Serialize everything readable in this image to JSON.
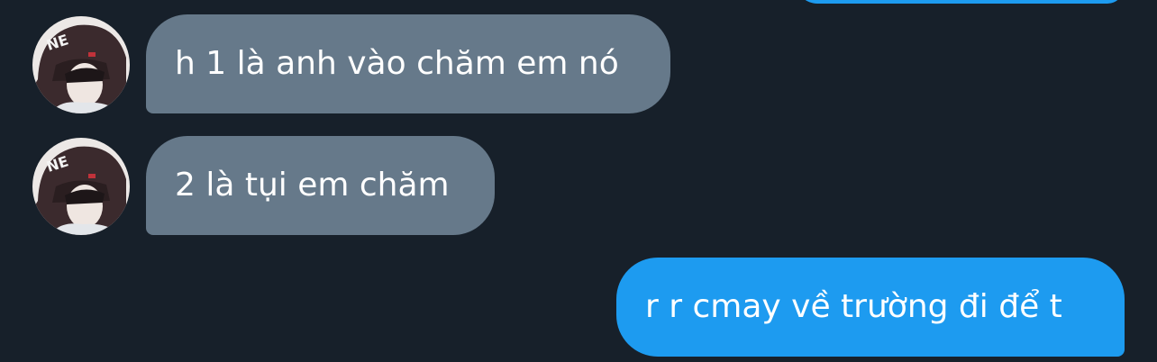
{
  "conversation": {
    "messages": [
      {
        "sender": "contact",
        "text": "h 1 là anh vào chăm em nó"
      },
      {
        "sender": "contact",
        "text": "2 là tụi em chăm"
      },
      {
        "sender": "me",
        "text": "r r cmay về trường đi để t"
      }
    ]
  },
  "colors": {
    "background": "#17202a",
    "incoming_bubble": "#66798a",
    "outgoing_bubble": "#1d9bf0",
    "text": "#ffffff"
  }
}
